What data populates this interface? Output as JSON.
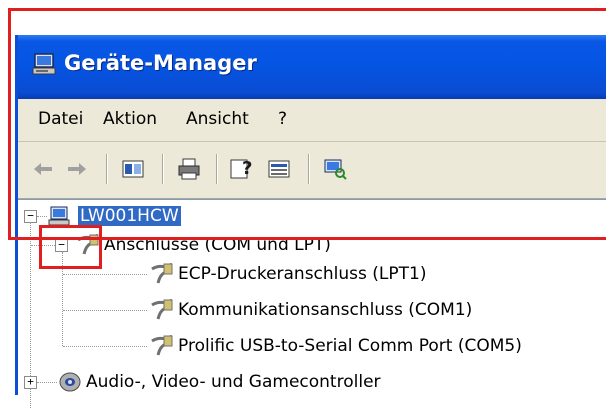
{
  "window": {
    "title": "Geräte-Manager",
    "accent_color": "#0a57e6",
    "title_icon": "computer-monitor-icon"
  },
  "menu": {
    "items": [
      "Datei",
      "Aktion",
      "Ansicht",
      "?"
    ]
  },
  "toolbar": {
    "buttons": [
      "back-arrow-icon",
      "forward-arrow-icon",
      "properties-view-icon",
      "print-icon",
      "help-icon",
      "details-pane-icon",
      "scan-hardware-icon"
    ]
  },
  "tree": {
    "root": {
      "label": "LW001HCW",
      "icon": "computer-icon",
      "selected": true
    },
    "group_ports": {
      "label": "Anschlüsse (COM und LPT)",
      "icon": "port-connector-icon",
      "expanded": true
    },
    "ports": [
      {
        "label": "ECP-Druckeranschluss (LPT1)",
        "icon": "port-connector-icon"
      },
      {
        "label": "Kommunikationsanschluss (COM1)",
        "icon": "port-connector-icon"
      },
      {
        "label": "Prolific USB-to-Serial Comm Port (COM5)",
        "icon": "port-connector-icon"
      }
    ],
    "group_audio": {
      "label": "Audio-, Video- und Gamecontroller",
      "icon": "speaker-icon",
      "expanded": false
    }
  },
  "annotation": {
    "highlight_color": "#e02020"
  }
}
